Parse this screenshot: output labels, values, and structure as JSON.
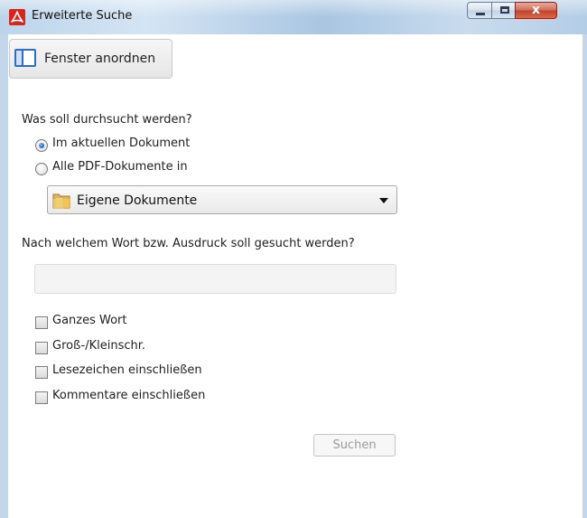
{
  "window": {
    "title": "Erweiterte Suche",
    "app_icon": "adobe-reader-icon",
    "controls": {
      "minimize_icon": "minimize-icon",
      "maximize_icon": "maximize-icon",
      "close_icon": "close-icon",
      "close_glyph": "x"
    }
  },
  "toolbar": {
    "arrange_label": "Fenster anordnen",
    "arrange_icon": "window-layout-icon"
  },
  "scope": {
    "question": "Was soll durchsucht werden?",
    "options": [
      {
        "label": "Im aktuellen Dokument",
        "checked": true
      },
      {
        "label": "Alle PDF-Dokumente in",
        "checked": false
      }
    ],
    "location": {
      "selected": "Eigene Dokumente",
      "icon": "folder-icon"
    }
  },
  "query": {
    "question": "Nach welchem Wort bzw. Ausdruck soll gesucht werden?",
    "value": "",
    "placeholder": ""
  },
  "options": [
    {
      "label": "Ganzes Wort",
      "checked": false
    },
    {
      "label": "Groß-/Kleinschr.",
      "checked": false
    },
    {
      "label": "Lesezeichen einschließen",
      "checked": false
    },
    {
      "label": "Kommentare einschließen",
      "checked": false
    }
  ],
  "actions": {
    "search_label": "Suchen",
    "search_enabled": false
  },
  "colors": {
    "accent": "#2c6ec7",
    "title_bar": "#bcd4ea",
    "close": "#c2432a",
    "adobe_red": "#d7251e"
  }
}
